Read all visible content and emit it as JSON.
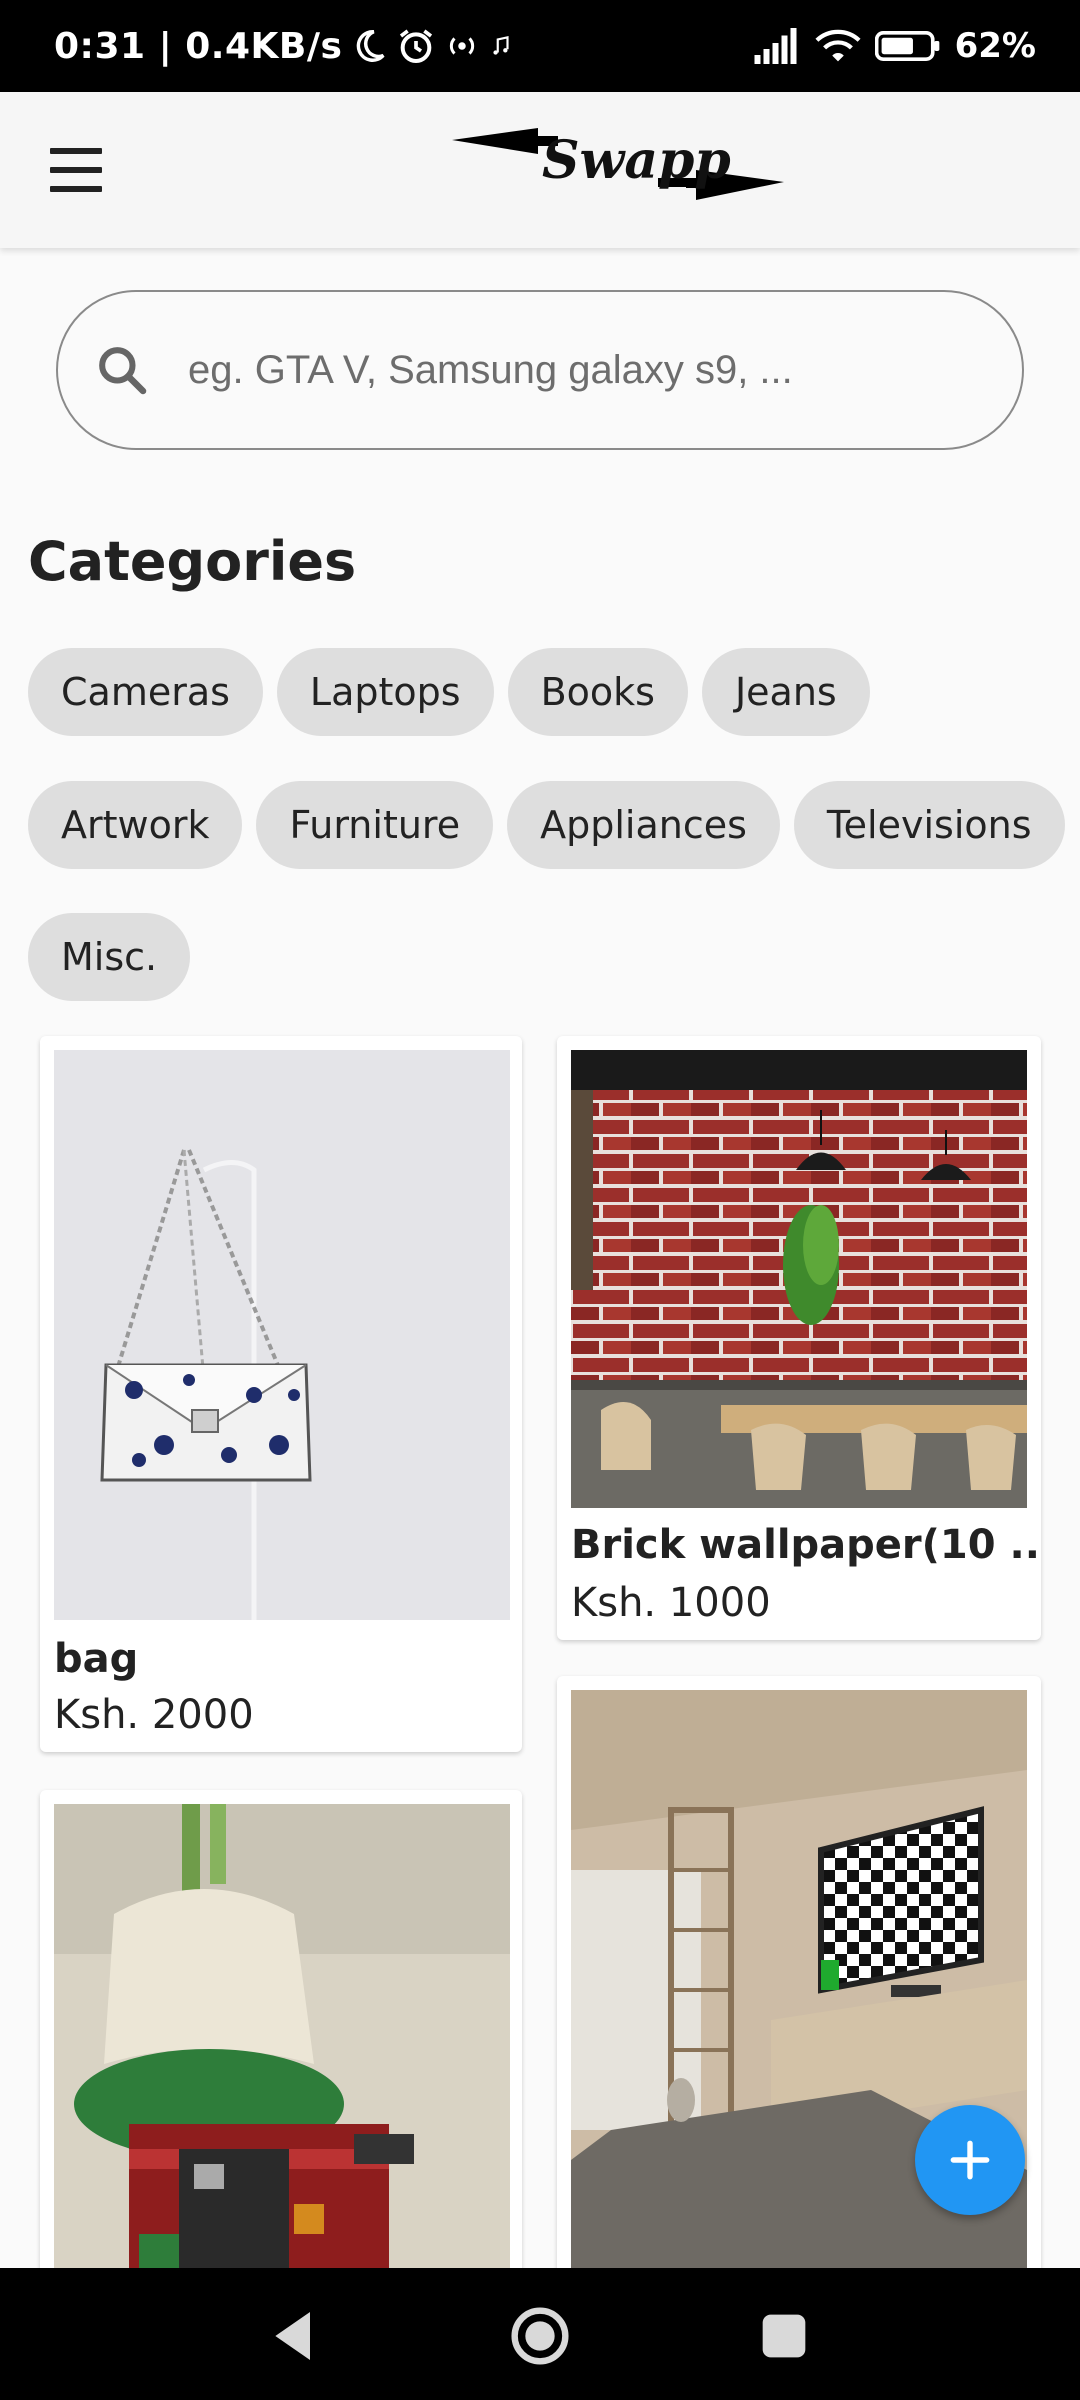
{
  "status_bar": {
    "time_speed": "0:31 | 0.4KB/s",
    "battery": "62%",
    "icons": [
      "moon-icon",
      "alarm-icon",
      "hotspot-icon",
      "music-icon",
      "signal-icon",
      "wifi-icon",
      "battery-icon"
    ]
  },
  "app_bar": {
    "logo_text": "Swapp",
    "menu_icon": "hamburger-menu-icon"
  },
  "search": {
    "placeholder": "eg. GTA V, Samsung galaxy s9, ...",
    "icon": "search-icon"
  },
  "categories": {
    "title": "Categories",
    "rows": [
      [
        "Cameras",
        "Laptops",
        "Books",
        "Jeans"
      ],
      [
        "Artwork",
        "Furniture",
        "Appliances",
        "Televisions"
      ],
      [
        "Misc."
      ]
    ]
  },
  "products": [
    {
      "title": "bag",
      "price": "Ksh. 2000",
      "image": "handbag-photo"
    },
    {
      "title": "Brick wallpaper(10 ...",
      "price": "Ksh. 1000",
      "image": "brick-wall-room-photo"
    },
    {
      "title": "",
      "price": "",
      "image": "lego-helmet-photo"
    },
    {
      "title": "",
      "price": "",
      "image": "tv-room-photo"
    }
  ],
  "fab": {
    "icon": "plus-icon"
  },
  "nav": {
    "icons": [
      "back-icon",
      "home-icon",
      "recents-icon"
    ]
  },
  "colors": {
    "accent": "#2196f3",
    "chip_bg": "#dedede",
    "background": "#fafafa"
  }
}
